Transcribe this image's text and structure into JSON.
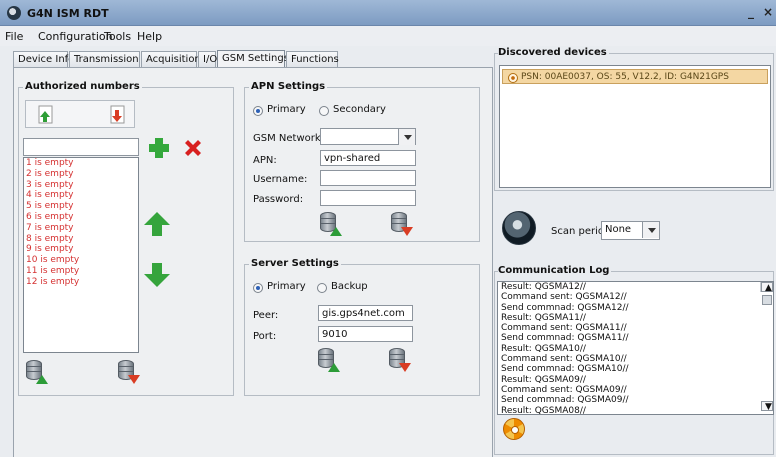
{
  "window": {
    "title": "G4N ISM RDT",
    "minimize": "_",
    "close": "×"
  },
  "menu": [
    "File",
    "Configuration",
    "Tools",
    "Help"
  ],
  "tabs": [
    "Device Info",
    "Transmission",
    "Acquisition",
    "I/O",
    "GSM Settings",
    "Functions"
  ],
  "active_tab": "GSM Settings",
  "authorized_numbers": {
    "title": "Authorized numbers",
    "input_value": "",
    "items": [
      "1 is empty",
      "2 is empty",
      "3 is empty",
      "4 is empty",
      "5 is empty",
      "6 is empty",
      "7 is empty",
      "8 is empty",
      "9 is empty",
      "10 is empty",
      "11 is empty",
      "12 is empty"
    ]
  },
  "apn_settings": {
    "title": "APN Settings",
    "primary_label": "Primary",
    "secondary_label": "Secondary",
    "gsm_network_label": "GSM Network",
    "gsm_network_value": "",
    "apn_label": "APN:",
    "apn_value": "vpn-shared",
    "username_label": "Username:",
    "username_value": "",
    "password_label": "Password:",
    "password_value": ""
  },
  "server_settings": {
    "title": "Server Settings",
    "primary_label": "Primary",
    "backup_label": "Backup",
    "peer_label": "Peer:",
    "peer_value": "gis.gps4net.com",
    "port_label": "Port:",
    "port_value": "9010"
  },
  "discovered_devices": {
    "title": "Discovered devices",
    "items": [
      "PSN: 00AE0037, OS: 55, V12.2, ID: G4N21GPS"
    ]
  },
  "scan": {
    "label": "Scan period",
    "value": "None"
  },
  "communication_log": {
    "title": "Communication Log",
    "lines": [
      "Result: QGSMA12//",
      "Command sent: QGSMA12//",
      "Send commnad: QGSMA12//",
      "Result: QGSMA11//",
      "Command sent: QGSMA11//",
      "Send commnad: QGSMA11//",
      "Result: QGSMA10//",
      "Command sent: QGSMA10//",
      "Send commnad: QGSMA10//",
      "Result: QGSMA09//",
      "Command sent: QGSMA09//",
      "Send commnad: QGSMA09//",
      "Result: QGSMA08//"
    ]
  },
  "colors": {
    "accent": "#2d61b6",
    "empty_number": "#d53131",
    "selected_device": "#f4d7a3"
  },
  "icons": [
    "app-logo-icon",
    "upload-green-icon",
    "download-red-icon",
    "add-plus-icon",
    "remove-x-icon",
    "move-up-icon",
    "move-down-icon",
    "database-upload-icon",
    "database-download-icon",
    "scan-radar-icon",
    "radiation-icon"
  ]
}
